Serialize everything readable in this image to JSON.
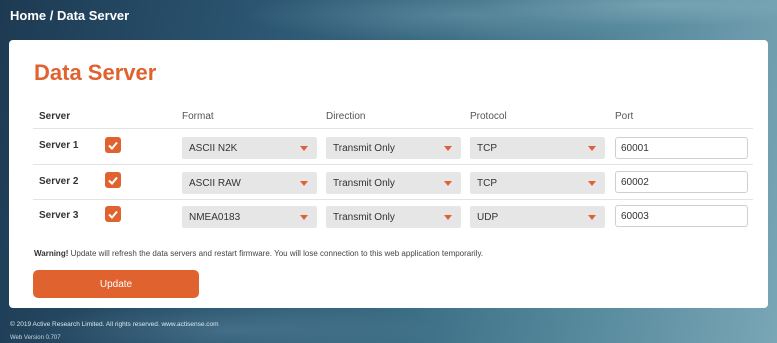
{
  "breadcrumb": "Home / Data Server",
  "page_title": "Data Server",
  "columns": {
    "server": "Server",
    "format": "Format",
    "direction": "Direction",
    "protocol": "Protocol",
    "port": "Port"
  },
  "servers": [
    {
      "label": "Server 1",
      "enabled": true,
      "format": "ASCII N2K",
      "direction": "Transmit Only",
      "protocol": "TCP",
      "port": "60001"
    },
    {
      "label": "Server 2",
      "enabled": true,
      "format": "ASCII RAW",
      "direction": "Transmit Only",
      "protocol": "TCP",
      "port": "60002"
    },
    {
      "label": "Server 3",
      "enabled": true,
      "format": "NMEA0183",
      "direction": "Transmit Only",
      "protocol": "UDP",
      "port": "60003"
    }
  ],
  "warning": {
    "prefix": "Warning!",
    "text": " Update will refresh the data servers and restart firmware. You will lose connection to this web application temporarily."
  },
  "update_label": "Update",
  "footer": {
    "copyright": "© 2019 Active Research Limited. All rights reserved.  www.actisense.com",
    "version": "Web Version 0.707"
  },
  "colors": {
    "accent": "#e0622f",
    "select_bg": "#e6e6e6"
  },
  "icons": {
    "checkbox": "checkmark-icon",
    "dropdown": "chevron-down-icon"
  }
}
